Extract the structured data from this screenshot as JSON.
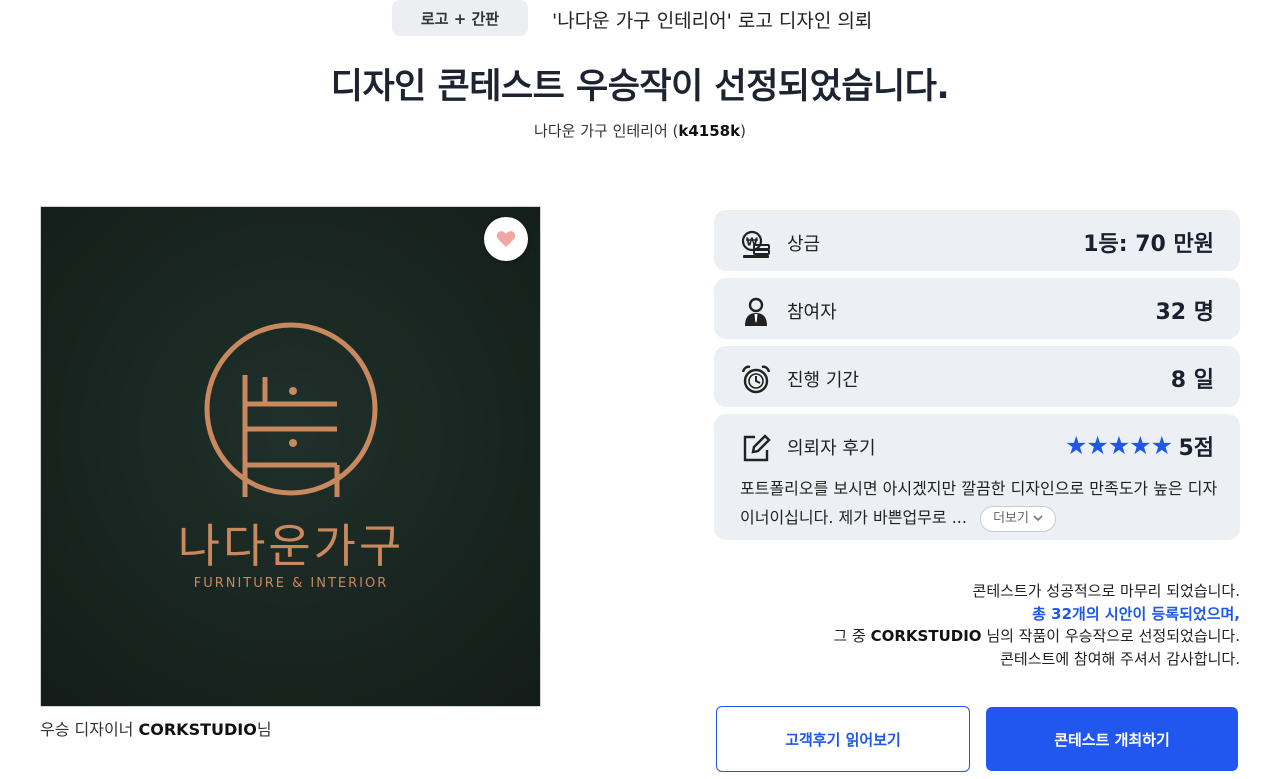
{
  "header": {
    "category_badge": "로고 + 간판",
    "contest_subject": "'나다운 가구 인테리어' 로고 디자인 의뢰",
    "title": "디자인 콘테스트 우승작이 선정되었습니다.",
    "client_name": "나다운 가구 인테리어 (",
    "client_id": "k4158k",
    "client_close": ")"
  },
  "artwork": {
    "logo_korean": "나다운가구",
    "logo_english": "FURNITURE & INTERIOR",
    "background_color": "#1a2521",
    "logo_color": "#c8895e",
    "favorite_icon": "heart-icon"
  },
  "winner": {
    "prefix": "우승 디자이너 ",
    "name": "CORKSTUDIO",
    "suffix": "님"
  },
  "info": {
    "prize": {
      "icon": "money-icon",
      "label": "상금",
      "value": "1등: 70 만원"
    },
    "participants": {
      "icon": "person-icon",
      "label": "참여자",
      "value": "32 명"
    },
    "period": {
      "icon": "alarm-clock-icon",
      "label": "진행 기간",
      "value": "8 일"
    },
    "review": {
      "icon": "edit-icon",
      "label": "의뢰자 후기",
      "stars": "★★★★★",
      "rating": 5,
      "rating_text": "5점",
      "text": "포트폴리오를 보시면 아시겠지만 깔끔한 디자인으로 만족도가 높은 디자이너이십니다. 제가 바쁜업무로 ...",
      "more_label": "더보기"
    }
  },
  "completion": {
    "line1": "콘테스트가 성공적으로 마무리 되었습니다.",
    "line2": "총 32개의 시안이 등록되었으며,",
    "line3_prefix": "그 중 ",
    "line3_name": "CORKSTUDIO",
    "line3_suffix": " 님의 작품이 우승작으로 선정되었습니다.",
    "line4": "콘테스트에 참여해 주셔서 감사합니다."
  },
  "buttons": {
    "read_reviews": "고객후기 읽어보기",
    "host_contest": "콘테스트 개최하기"
  },
  "colors": {
    "accent": "#1f58e8",
    "card_bg": "#eceff3",
    "star": "#1f58e8"
  }
}
